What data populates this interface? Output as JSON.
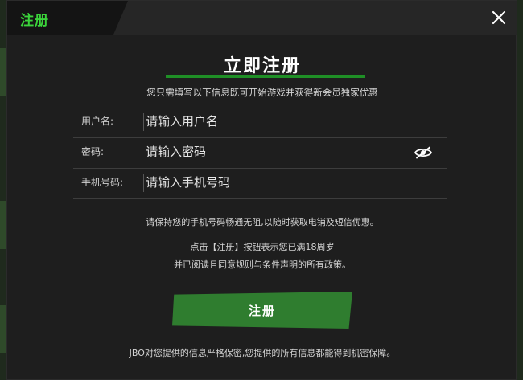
{
  "header": {
    "title": "注册"
  },
  "main": {
    "title": "立即注册",
    "subtitle": "您只需填写以下信息既可开始游戏并获得新会员独家优惠"
  },
  "form": {
    "username": {
      "label": "用户名:",
      "placeholder": "请输入用户名"
    },
    "password": {
      "label": "密码:",
      "placeholder": "请输入密码"
    },
    "phone": {
      "label": "手机号码:",
      "placeholder": "请输入手机号码"
    }
  },
  "notices": {
    "phone_note": "请保持您的手机号码畅通无阻,以随时获取电销及短信优惠。",
    "age_note": "点击【注册】按钮表示您已满18周岁",
    "policy_note": "并已阅读且同意规则与条件声明的所有政策。"
  },
  "submit": {
    "label": "注册"
  },
  "footer": {
    "text": "JBO对您提供的信息严格保密,您提供的所有信息都能得到机密保障。"
  },
  "colors": {
    "accent_green": "#3bd43b",
    "button_green": "#2f7d2f",
    "underline_green": "#1f8f26",
    "modal_bg": "#1e1e1e"
  },
  "icons": {
    "close": "close-icon",
    "password_visibility": "eye-off-icon"
  }
}
